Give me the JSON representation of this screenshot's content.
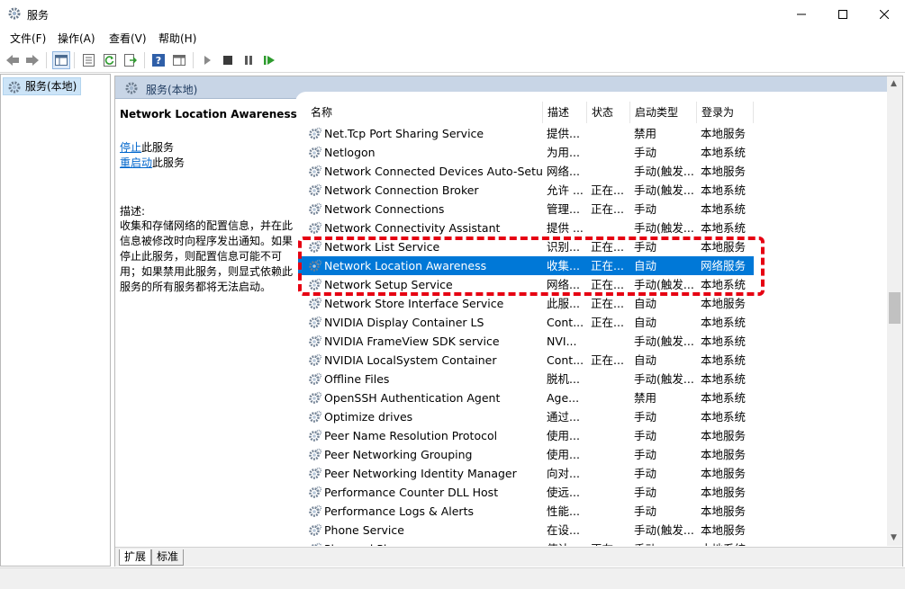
{
  "window": {
    "title": "服务",
    "icon": "services-gear-icon"
  },
  "menu": [
    "文件(F)",
    "操作(A)",
    "查看(V)",
    "帮助(H)"
  ],
  "toolbar": {
    "icons": [
      "back-arrow-icon",
      "forward-arrow-icon",
      "show-console-tree-icon",
      "properties-icon",
      "refresh-icon",
      "export-list-icon",
      "help-icon",
      "show-action-pane-icon",
      "start-service-icon",
      "stop-service-icon",
      "pause-service-icon",
      "restart-service-icon"
    ]
  },
  "tree": {
    "item": "服务(本地)"
  },
  "pane": {
    "header": "服务(本地)"
  },
  "detail": {
    "title": "Network Location Awareness",
    "stop_link": "停止",
    "stop_suffix": "此服务",
    "restart_link": "重启动",
    "restart_suffix": "此服务",
    "desc_label": "描述:",
    "desc_text": "收集和存储网络的配置信息，并在此信息被修改时向程序发出通知。如果停止此服务，则配置信息可能不可用；如果禁用此服务，则显式依赖此服务的所有服务都将无法启动。"
  },
  "columns": {
    "name": "名称",
    "desc": "描述",
    "status": "状态",
    "startup": "启动类型",
    "logon": "登录为"
  },
  "services": [
    {
      "name": "Net.Tcp Port Sharing Service",
      "desc": "提供...",
      "status": "",
      "startup": "禁用",
      "logon": "本地服务"
    },
    {
      "name": "Netlogon",
      "desc": "为用...",
      "status": "",
      "startup": "手动",
      "logon": "本地系统"
    },
    {
      "name": "Network Connected Devices Auto-Setup",
      "desc": "网络...",
      "status": "",
      "startup": "手动(触发...",
      "logon": "本地服务"
    },
    {
      "name": "Network Connection Broker",
      "desc": "允许 ...",
      "status": "正在...",
      "startup": "手动(触发...",
      "logon": "本地系统"
    },
    {
      "name": "Network Connections",
      "desc": "管理...",
      "status": "正在...",
      "startup": "手动",
      "logon": "本地系统"
    },
    {
      "name": "Network Connectivity Assistant",
      "desc": "提供 ...",
      "status": "",
      "startup": "手动(触发...",
      "logon": "本地系统"
    },
    {
      "name": "Network List Service",
      "desc": "识别...",
      "status": "正在...",
      "startup": "手动",
      "logon": "本地服务"
    },
    {
      "name": "Network Location Awareness",
      "desc": "收集...",
      "status": "正在...",
      "startup": "自动",
      "logon": "网络服务",
      "selected": true
    },
    {
      "name": "Network Setup Service",
      "desc": "网络...",
      "status": "正在...",
      "startup": "手动(触发...",
      "logon": "本地系统"
    },
    {
      "name": "Network Store Interface Service",
      "desc": "此服...",
      "status": "正在...",
      "startup": "自动",
      "logon": "本地服务"
    },
    {
      "name": "NVIDIA Display Container LS",
      "desc": "Cont...",
      "status": "正在...",
      "startup": "自动",
      "logon": "本地系统"
    },
    {
      "name": "NVIDIA FrameView SDK service",
      "desc": "NVI...",
      "status": "",
      "startup": "手动(触发...",
      "logon": "本地系统"
    },
    {
      "name": "NVIDIA LocalSystem Container",
      "desc": "Cont...",
      "status": "正在...",
      "startup": "自动",
      "logon": "本地系统"
    },
    {
      "name": "Offline Files",
      "desc": "脱机...",
      "status": "",
      "startup": "手动(触发...",
      "logon": "本地系统"
    },
    {
      "name": "OpenSSH Authentication Agent",
      "desc": "Age...",
      "status": "",
      "startup": "禁用",
      "logon": "本地系统"
    },
    {
      "name": "Optimize drives",
      "desc": "通过...",
      "status": "",
      "startup": "手动",
      "logon": "本地系统"
    },
    {
      "name": "Peer Name Resolution Protocol",
      "desc": "使用...",
      "status": "",
      "startup": "手动",
      "logon": "本地服务"
    },
    {
      "name": "Peer Networking Grouping",
      "desc": "使用...",
      "status": "",
      "startup": "手动",
      "logon": "本地服务"
    },
    {
      "name": "Peer Networking Identity Manager",
      "desc": "向对...",
      "status": "",
      "startup": "手动",
      "logon": "本地服务"
    },
    {
      "name": "Performance Counter DLL Host",
      "desc": "使远...",
      "status": "",
      "startup": "手动",
      "logon": "本地服务"
    },
    {
      "name": "Performance Logs & Alerts",
      "desc": "性能...",
      "status": "",
      "startup": "手动",
      "logon": "本地服务"
    },
    {
      "name": "Phone Service",
      "desc": "在设...",
      "status": "",
      "startup": "手动(触发...",
      "logon": "本地服务"
    },
    {
      "name": "Plug and Play",
      "desc": "使计...",
      "status": "正在...",
      "startup": "手动",
      "logon": "本地系统"
    }
  ],
  "tabs": [
    "扩展",
    "标准"
  ],
  "colors": {
    "selection": "#0078d7",
    "highlight_box": "#e60012",
    "header_band": "#c8d5e6"
  }
}
